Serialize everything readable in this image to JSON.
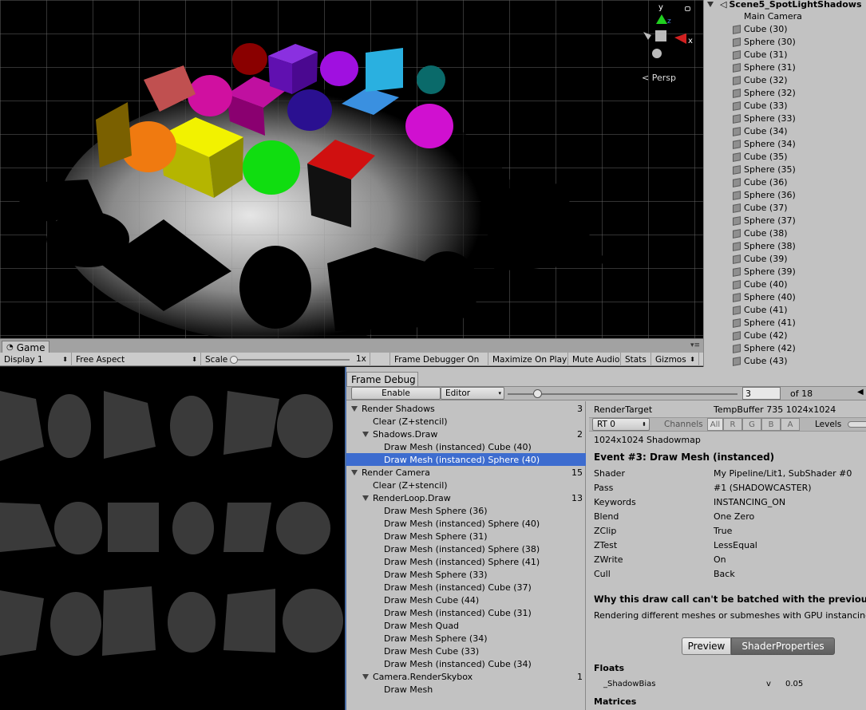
{
  "scene": {
    "persp_label": "< Persp",
    "gizmo_axes": [
      "y",
      "z",
      "x"
    ]
  },
  "hierarchy": {
    "root": "Scene5_SpotLightShadows",
    "items": [
      "Main Camera",
      "Cube (30)",
      "Sphere (30)",
      "Cube (31)",
      "Sphere (31)",
      "Cube (32)",
      "Sphere (32)",
      "Cube (33)",
      "Sphere (33)",
      "Cube (34)",
      "Sphere (34)",
      "Cube (35)",
      "Sphere (35)",
      "Cube (36)",
      "Sphere (36)",
      "Cube (37)",
      "Sphere (37)",
      "Cube (38)",
      "Sphere (38)",
      "Cube (39)",
      "Sphere (39)",
      "Cube (40)",
      "Sphere (40)",
      "Cube (41)",
      "Sphere (41)",
      "Cube (42)",
      "Sphere (42)",
      "Cube (43)"
    ]
  },
  "game": {
    "tab": "Game",
    "display": "Display 1",
    "aspect": "Free Aspect",
    "scale_label": "Scale",
    "scale_value": "1x",
    "frame_debugger": "Frame Debugger On",
    "maximize": "Maximize On Play",
    "mute": "Mute Audio",
    "stats": "Stats",
    "gizmos": "Gizmos"
  },
  "frame_debug": {
    "tab": "Frame Debug",
    "enable": "Enable",
    "editor": "Editor",
    "event_index": "3",
    "of_total": "of 18",
    "tree": [
      {
        "label": "Render Shadows",
        "count": "3",
        "indent": 0,
        "arrow": true
      },
      {
        "label": "Clear (Z+stencil)",
        "count": "",
        "indent": 1,
        "arrow": false
      },
      {
        "label": "Shadows.Draw",
        "count": "2",
        "indent": 1,
        "arrow": true
      },
      {
        "label": "Draw Mesh (instanced) Cube (40)",
        "count": "",
        "indent": 2,
        "arrow": false
      },
      {
        "label": "Draw Mesh (instanced) Sphere (40)",
        "count": "",
        "indent": 2,
        "arrow": false,
        "selected": true
      },
      {
        "label": "Render Camera",
        "count": "15",
        "indent": 0,
        "arrow": true
      },
      {
        "label": "Clear (Z+stencil)",
        "count": "",
        "indent": 1,
        "arrow": false
      },
      {
        "label": "RenderLoop.Draw",
        "count": "13",
        "indent": 1,
        "arrow": true
      },
      {
        "label": "Draw Mesh Sphere (36)",
        "count": "",
        "indent": 2,
        "arrow": false
      },
      {
        "label": "Draw Mesh (instanced) Sphere (40)",
        "count": "",
        "indent": 2,
        "arrow": false
      },
      {
        "label": "Draw Mesh Sphere (31)",
        "count": "",
        "indent": 2,
        "arrow": false
      },
      {
        "label": "Draw Mesh (instanced) Sphere (38)",
        "count": "",
        "indent": 2,
        "arrow": false
      },
      {
        "label": "Draw Mesh (instanced) Sphere (41)",
        "count": "",
        "indent": 2,
        "arrow": false
      },
      {
        "label": "Draw Mesh Sphere (33)",
        "count": "",
        "indent": 2,
        "arrow": false
      },
      {
        "label": "Draw Mesh (instanced) Cube (37)",
        "count": "",
        "indent": 2,
        "arrow": false
      },
      {
        "label": "Draw Mesh Cube (44)",
        "count": "",
        "indent": 2,
        "arrow": false
      },
      {
        "label": "Draw Mesh (instanced) Cube (31)",
        "count": "",
        "indent": 2,
        "arrow": false
      },
      {
        "label": "Draw Mesh Quad",
        "count": "",
        "indent": 2,
        "arrow": false
      },
      {
        "label": "Draw Mesh Sphere (34)",
        "count": "",
        "indent": 2,
        "arrow": false
      },
      {
        "label": "Draw Mesh Cube (33)",
        "count": "",
        "indent": 2,
        "arrow": false
      },
      {
        "label": "Draw Mesh (instanced) Cube (34)",
        "count": "",
        "indent": 2,
        "arrow": false
      },
      {
        "label": "Camera.RenderSkybox",
        "count": "1",
        "indent": 1,
        "arrow": true
      },
      {
        "label": "Draw Mesh",
        "count": "",
        "indent": 2,
        "arrow": false
      }
    ],
    "details": {
      "render_target_label": "RenderTarget",
      "render_target_value": "TempBuffer 735 1024x1024",
      "rt": "RT 0",
      "channels": "Channels",
      "channel_buttons": [
        "All",
        "R",
        "G",
        "B",
        "A"
      ],
      "levels": "Levels",
      "size_label": "1024x1024 Shadowmap",
      "event_title": "Event #3: Draw Mesh (instanced)",
      "props": [
        {
          "k": "Shader",
          "v": "My Pipeline/Lit1, SubShader #0"
        },
        {
          "k": "Pass",
          "v": "#1 (SHADOWCASTER)"
        },
        {
          "k": "Keywords",
          "v": "INSTANCING_ON"
        },
        {
          "k": "Blend",
          "v": "One Zero"
        },
        {
          "k": "ZClip",
          "v": "True"
        },
        {
          "k": "ZTest",
          "v": "LessEqual"
        },
        {
          "k": "ZWrite",
          "v": "On"
        },
        {
          "k": "Cull",
          "v": "Back"
        }
      ],
      "batch_title": "Why this draw call can't be batched with the previous one",
      "batch_reason": "Rendering different meshes or submeshes with GPU instancing.",
      "preview_btn": "Preview",
      "shaderprops_btn": "ShaderProperties",
      "floats": "Floats",
      "float_name": "_ShadowBias",
      "float_type": "v",
      "float_value": "0.05",
      "matrices": "Matrices"
    }
  }
}
